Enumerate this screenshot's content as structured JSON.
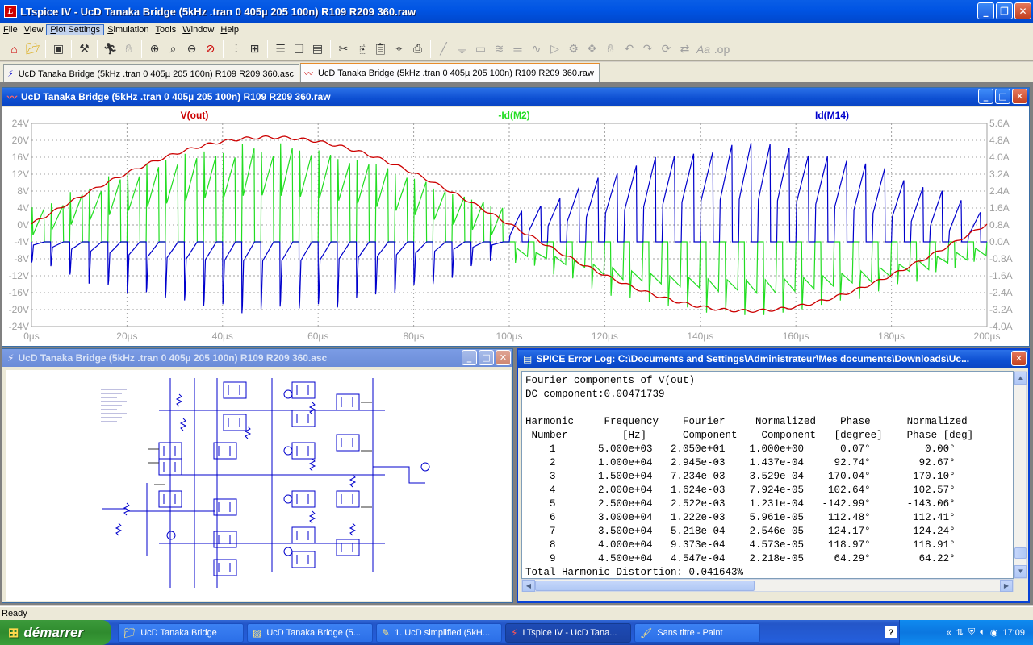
{
  "app": {
    "title": "LTspice IV - UcD Tanaka Bridge (5kHz .tran 0 405µ 205 100n) R109 R209 360.raw",
    "icon_letter": "LT"
  },
  "menu": [
    "File",
    "View",
    "Plot Settings",
    "Simulation",
    "Tools",
    "Window",
    "Help"
  ],
  "tabs": [
    {
      "label": "UcD Tanaka Bridge (5kHz .tran 0 405µ 205 100n) R109 R209 360.asc",
      "icon": "schematic-icon"
    },
    {
      "label": "UcD Tanaka Bridge (5kHz .tran 0 405µ 205 100n) R109 R209 360.raw",
      "icon": "waveform-icon"
    }
  ],
  "plot_window": {
    "title": "UcD Tanaka Bridge (5kHz .tran 0 405µ 205 100n) R109 R209 360.raw"
  },
  "schematic_window": {
    "title": "UcD Tanaka Bridge (5kHz .tran 0 405µ 205 100n) R109 R209 360.asc"
  },
  "log_window": {
    "title": "SPICE Error Log: C:\\Documents and Settings\\Administrateur\\Mes documents\\Downloads\\Uc...",
    "lines": [
      "Fourier components of V(out)",
      "DC component:0.00471739",
      "",
      "Harmonic     Frequency    Fourier     Normalized    Phase      Normalized",
      " Number         [Hz]      Component    Component   [degree]    Phase [deg]",
      "    1       5.000e+03   2.050e+01    1.000e+00      0.07°         0.00°",
      "    2       1.000e+04   2.945e-03    1.437e-04     92.74°        92.67°",
      "    3       1.500e+04   7.234e-03    3.529e-04   -170.04°      -170.10°",
      "    4       2.000e+04   1.624e-03    7.924e-05    102.64°       102.57°",
      "    5       2.500e+04   2.522e-03    1.231e-04   -142.99°      -143.06°",
      "    6       3.000e+04   1.222e-03    5.961e-05    112.48°       112.41°",
      "    7       3.500e+04   5.218e-04    2.546e-05   -124.17°      -124.24°",
      "    8       4.000e+04   9.373e-04    4.573e-05    118.97°       118.91°",
      "    9       4.500e+04   4.547e-04    2.218e-05     64.29°        64.22°",
      "Total Harmonic Distortion: 0.041643%"
    ]
  },
  "status": "Ready",
  "taskbar": {
    "start_label": "démarrer",
    "tasks": [
      {
        "label": "UcD Tanaka Bridge",
        "icon": "folder-icon",
        "active": false
      },
      {
        "label": "UcD Tanaka Bridge (5...",
        "icon": "image-icon",
        "active": false
      },
      {
        "label": "1. UcD simplified (5kH...",
        "icon": "document-icon",
        "active": false
      },
      {
        "label": "LTspice IV - UcD Tana...",
        "icon": "ltspice-icon",
        "active": true
      },
      {
        "label": "Sans titre - Paint",
        "icon": "paint-icon",
        "active": false
      }
    ],
    "clock": "17:09"
  },
  "colors": {
    "vout": "#cc0000",
    "id_m2": "#22dd22",
    "id_m14": "#0000cc",
    "grid": "#a0a0a0"
  },
  "chart_data": {
    "type": "line",
    "series": [
      {
        "name": "V(out)",
        "color": "#cc0000",
        "unit": "V",
        "x_us": [
          0,
          10,
          20,
          30,
          40,
          50,
          60,
          70,
          80,
          90,
          100,
          110,
          120,
          130,
          140,
          150,
          160,
          170,
          180,
          190,
          200
        ],
        "values": [
          0,
          6.2,
          11.7,
          16.2,
          19.3,
          20.5,
          19.8,
          16.9,
          12.5,
          6.6,
          0.4,
          -5.8,
          -11.4,
          -16.1,
          -19.2,
          -20.5,
          -20.1,
          -17.8,
          -12.6,
          -6.0,
          0.6
        ]
      },
      {
        "name": "-Id(M2)",
        "color": "#22dd22",
        "unit": "A",
        "description": "switching current ramps, 0 to ~4A in first half, 0 to ~-3.2A in second half"
      },
      {
        "name": "Id(M14)",
        "color": "#0000cc",
        "unit": "A",
        "description": "switching current ramps, 0 to ~-3A in first half, 0 to ~4A in second half"
      }
    ],
    "x_label": "",
    "x_ticks": [
      "0µs",
      "20µs",
      "40µs",
      "60µs",
      "80µs",
      "100µs",
      "120µs",
      "140µs",
      "160µs",
      "180µs",
      "200µs"
    ],
    "xlim": [
      0,
      200
    ],
    "y_left_ticks": [
      "24V",
      "20V",
      "16V",
      "12V",
      "8V",
      "4V",
      "0V",
      "-4V",
      "-8V",
      "-12V",
      "-16V",
      "-20V",
      "-24V"
    ],
    "y_left_lim": [
      -24,
      24
    ],
    "y_right_ticks": [
      "5.6A",
      "4.8A",
      "4.0A",
      "3.2A",
      "2.4A",
      "1.6A",
      "0.8A",
      "0.0A",
      "-0.8A",
      "-1.6A",
      "-2.4A",
      "-3.2A",
      "-4.0A"
    ],
    "y_right_lim": [
      -4.0,
      5.6
    ],
    "grid": true
  }
}
